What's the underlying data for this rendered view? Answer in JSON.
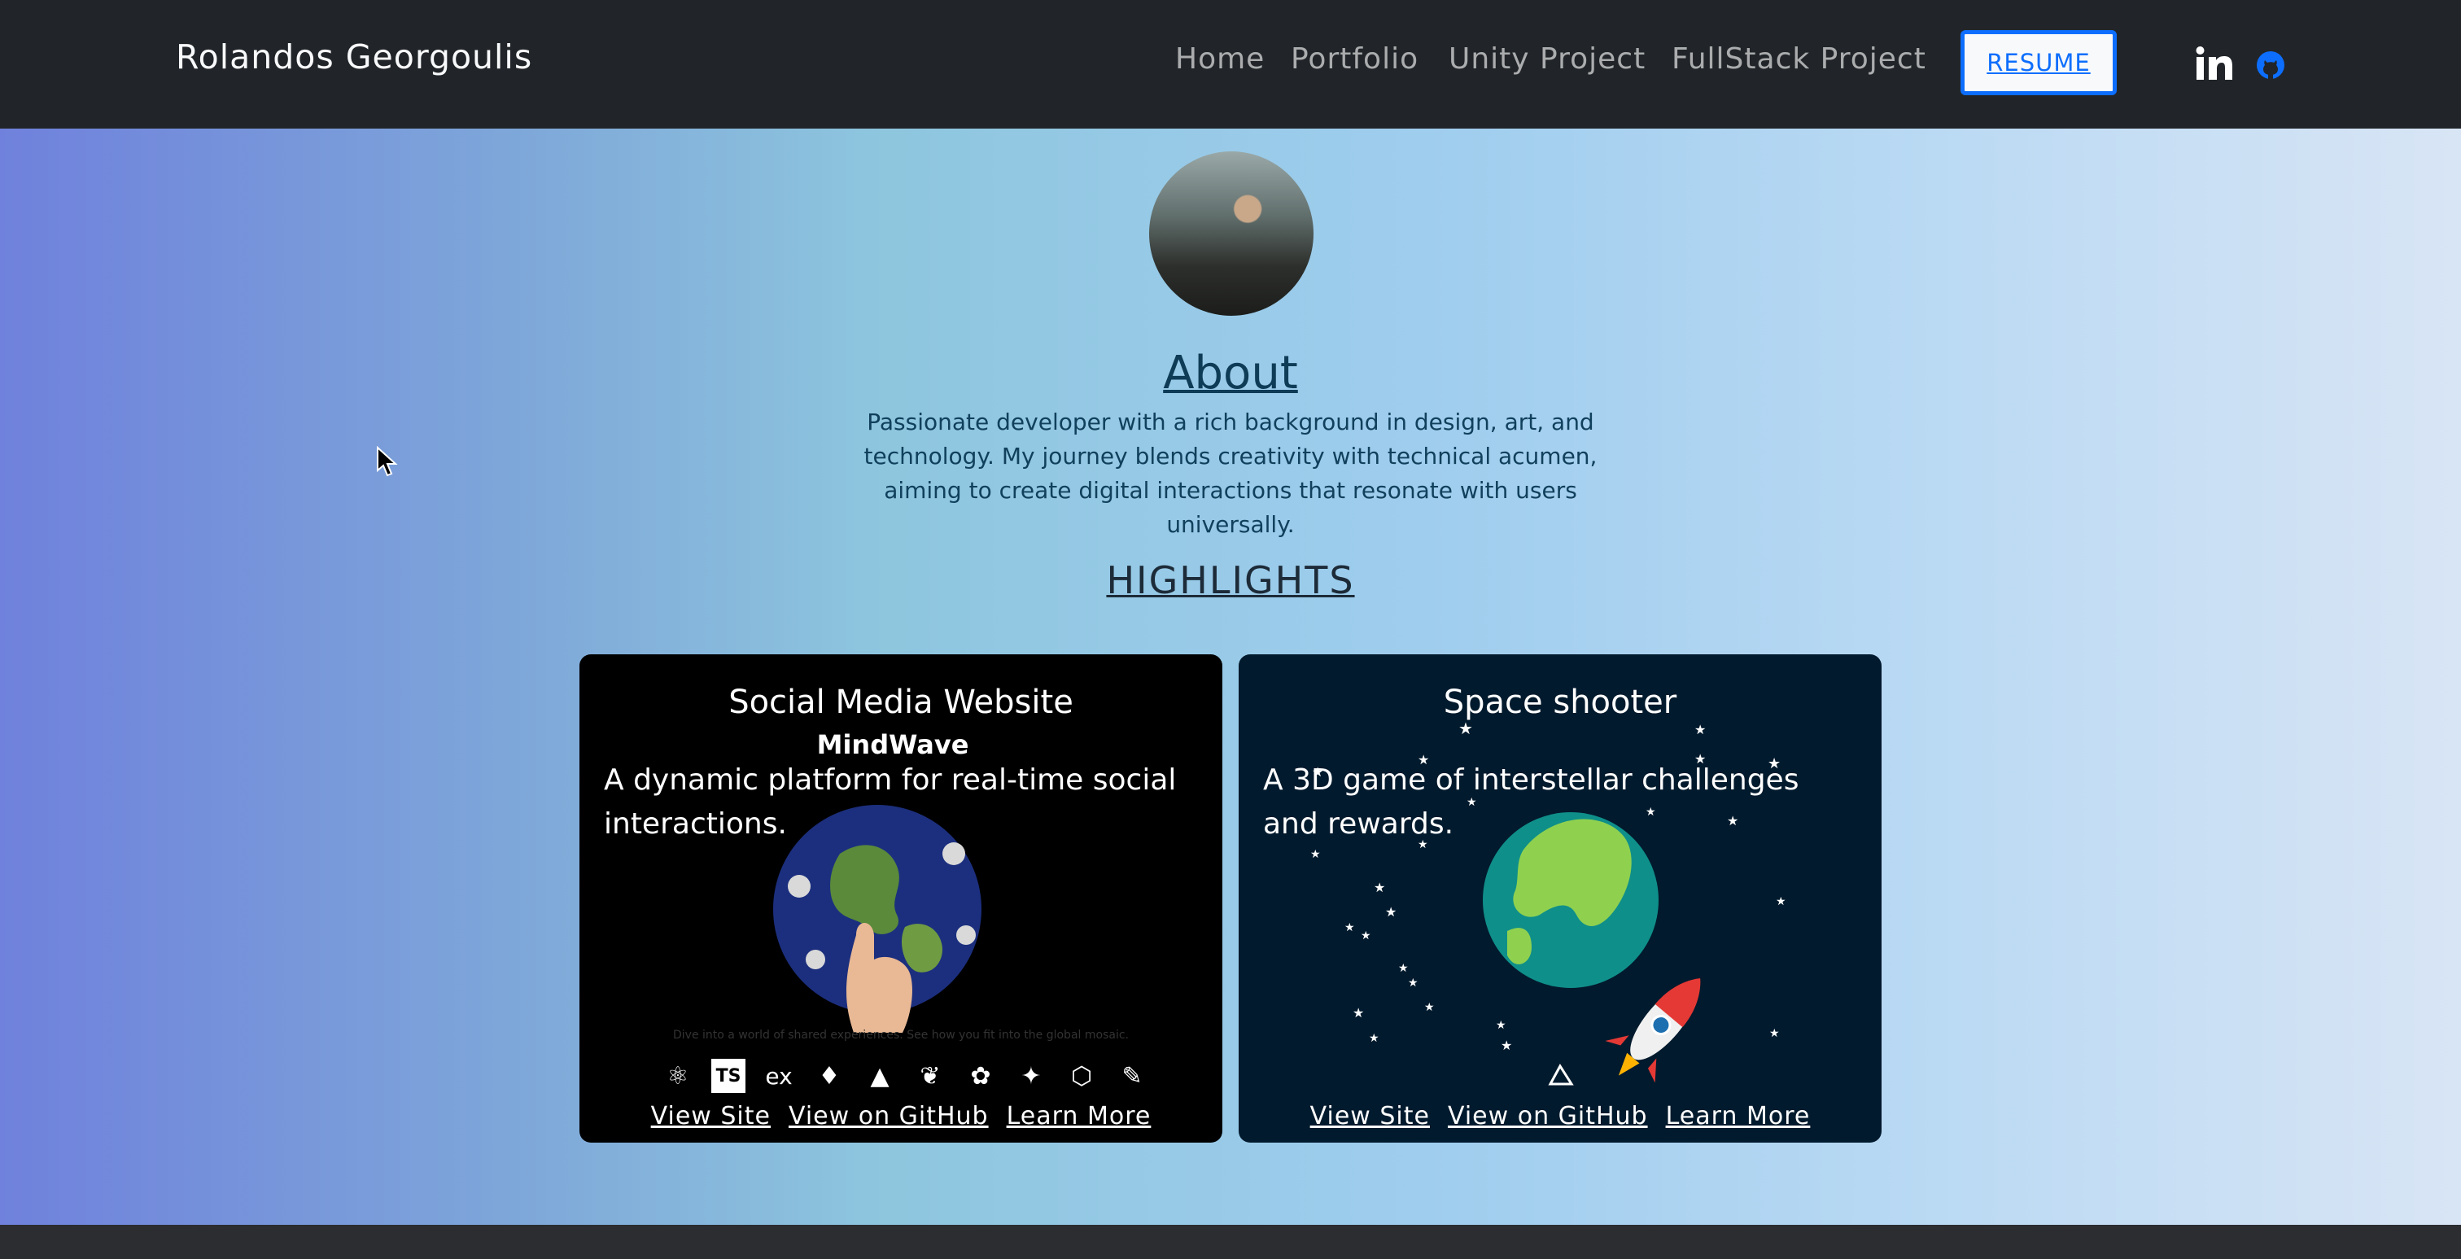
{
  "header": {
    "brand": "Rolandos Georgoulis",
    "nav": [
      "Home",
      "Portfolio",
      "Unity Project",
      "FullStack Project"
    ],
    "resume_label": "RESUME",
    "social_icons": [
      "linkedin-icon",
      "github-icon"
    ]
  },
  "about": {
    "title": "About",
    "text": "Passionate developer with a rich background in design, art, and technology. My journey blends creativity with technical acumen, aiming to create digital interactions that resonate with users universally."
  },
  "highlights": {
    "title": "HIGHLIGHTS",
    "cards": [
      {
        "title": "Social Media Website",
        "subtitle": "MindWave",
        "description": "A dynamic platform for real-time social interactions.",
        "caption": "Dive into a world of shared experiences. See how you fit into the global mosaic.",
        "tech_icons": [
          "react-icon",
          "typescript-icon",
          "express-icon",
          "mongodb-icon",
          "prisma-icon",
          "leaf-icon",
          "sass-icon",
          "jest-icon",
          "nodejs-icon",
          "other-icon"
        ],
        "typescript_label": "TS",
        "express_label": "ex",
        "links": [
          "View Site",
          "View on GitHub",
          "Learn More"
        ]
      },
      {
        "title": "Space shooter",
        "description": "A 3D game of interstellar challenges and rewards.",
        "links": [
          "View Site",
          "View on GitHub",
          "Learn More"
        ]
      }
    ]
  },
  "colors": {
    "navbar": "#212529",
    "resume_border": "#0d6efd",
    "space_card": "#021a2d"
  }
}
